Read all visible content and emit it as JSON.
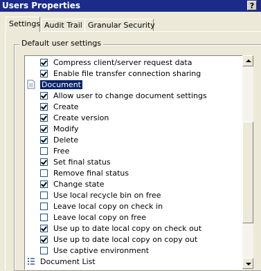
{
  "window": {
    "title": "Users Properties",
    "help_label": "?"
  },
  "tabs": [
    {
      "label": "Settings",
      "active": true
    },
    {
      "label": "Audit Trail",
      "active": false
    },
    {
      "label": "Granular Security",
      "active": false
    }
  ],
  "group": {
    "legend": "Default user settings"
  },
  "tree": {
    "items": [
      {
        "label": "Compress client/server request data",
        "checked": true
      },
      {
        "label": "Enable file transfer connection sharing",
        "checked": true
      },
      {
        "label": "Document",
        "node": true,
        "selected": true,
        "icon": "document-icon"
      },
      {
        "label": "Allow user to change document settings",
        "checked": true
      },
      {
        "label": "Create",
        "checked": true
      },
      {
        "label": "Create version",
        "checked": true
      },
      {
        "label": "Modify",
        "checked": true
      },
      {
        "label": "Delete",
        "checked": true
      },
      {
        "label": "Free",
        "checked": false
      },
      {
        "label": "Set final status",
        "checked": true
      },
      {
        "label": "Remove final status",
        "checked": false
      },
      {
        "label": "Change state",
        "checked": true
      },
      {
        "label": "Use local recycle bin on free",
        "checked": false
      },
      {
        "label": "Leave local copy on check in",
        "checked": false
      },
      {
        "label": "Leave local copy on free",
        "checked": false
      },
      {
        "label": "Use up to date local copy on check out",
        "checked": true
      },
      {
        "label": "Use up to date local copy on copy out",
        "checked": true
      },
      {
        "label": "Use captive environment",
        "checked": false
      },
      {
        "label": "Document List",
        "node": true,
        "selected": false,
        "icon": "list-icon"
      }
    ]
  }
}
